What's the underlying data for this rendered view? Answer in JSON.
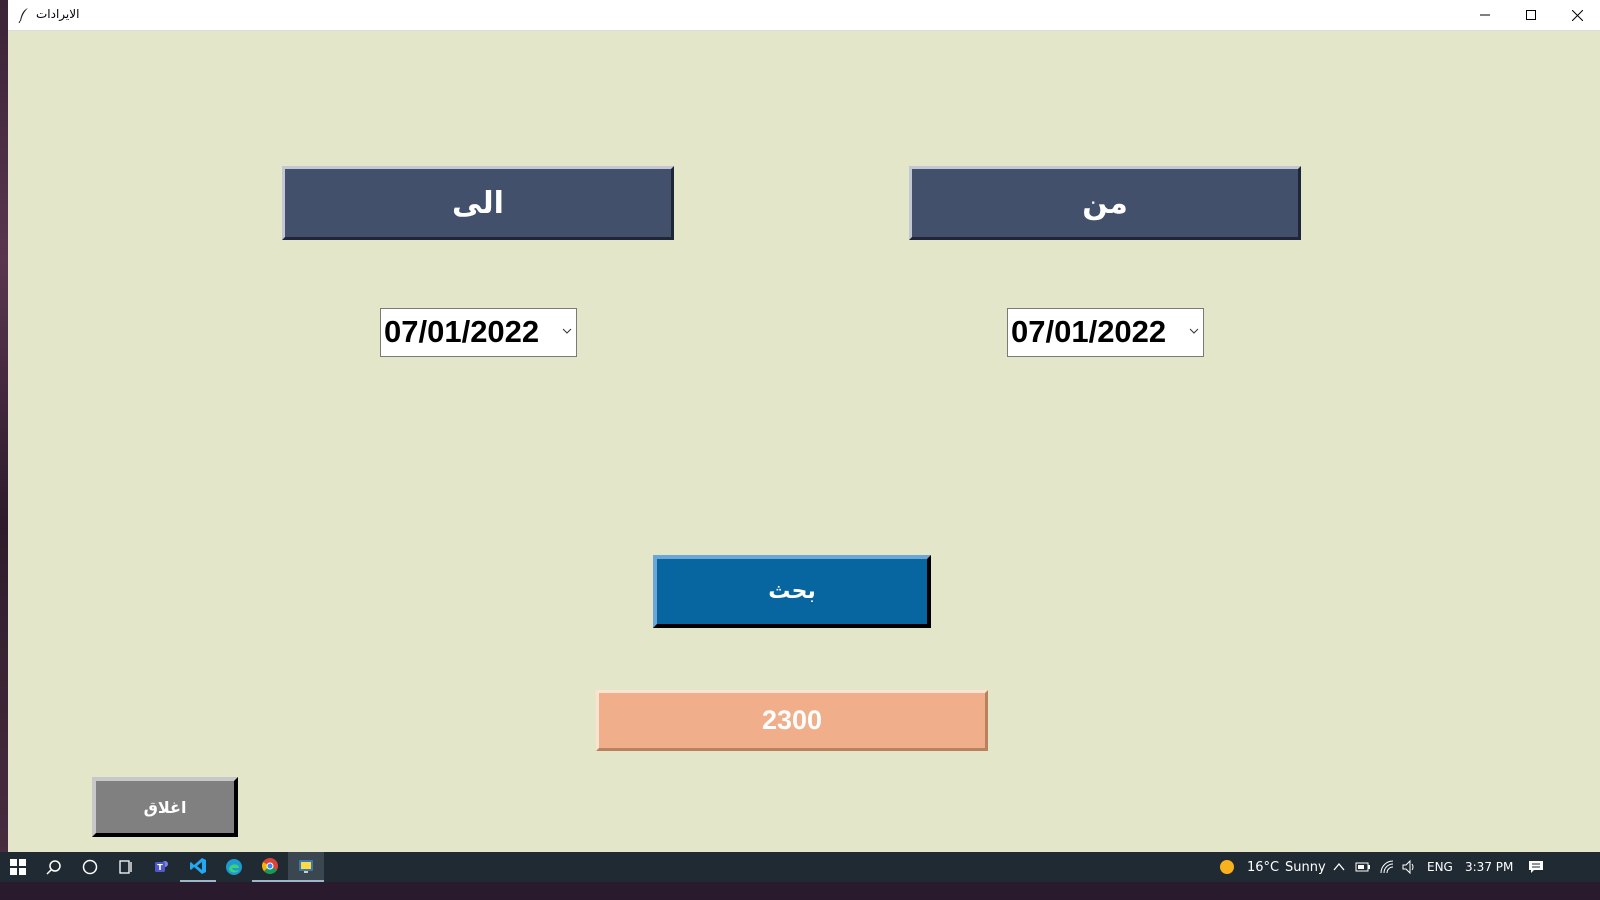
{
  "window": {
    "title": "الايرادات"
  },
  "labels": {
    "from_header": "من",
    "to_header": "الى"
  },
  "date_pickers": {
    "from_value": "07/01/2022",
    "to_value": "07/01/2022"
  },
  "actions": {
    "search_label": "بحث",
    "close_label": "اغلاق"
  },
  "result": {
    "total": "2300"
  },
  "taskbar": {
    "apps": [
      "start-icon",
      "search-icon",
      "cortana-icon",
      "task-view-icon",
      "teams-icon",
      "vscode-icon",
      "edge-icon",
      "chrome-icon",
      "python-icon"
    ],
    "weather_temp": "16°C",
    "weather_text": "Sunny",
    "language": "ENG",
    "time": "3:37 PM"
  },
  "colors": {
    "window_bg": "#e3e6c8",
    "header_bg": "#43506c",
    "search_bg": "#07659f",
    "result_bg": "#f0ae8b",
    "close_bg": "#808080"
  }
}
